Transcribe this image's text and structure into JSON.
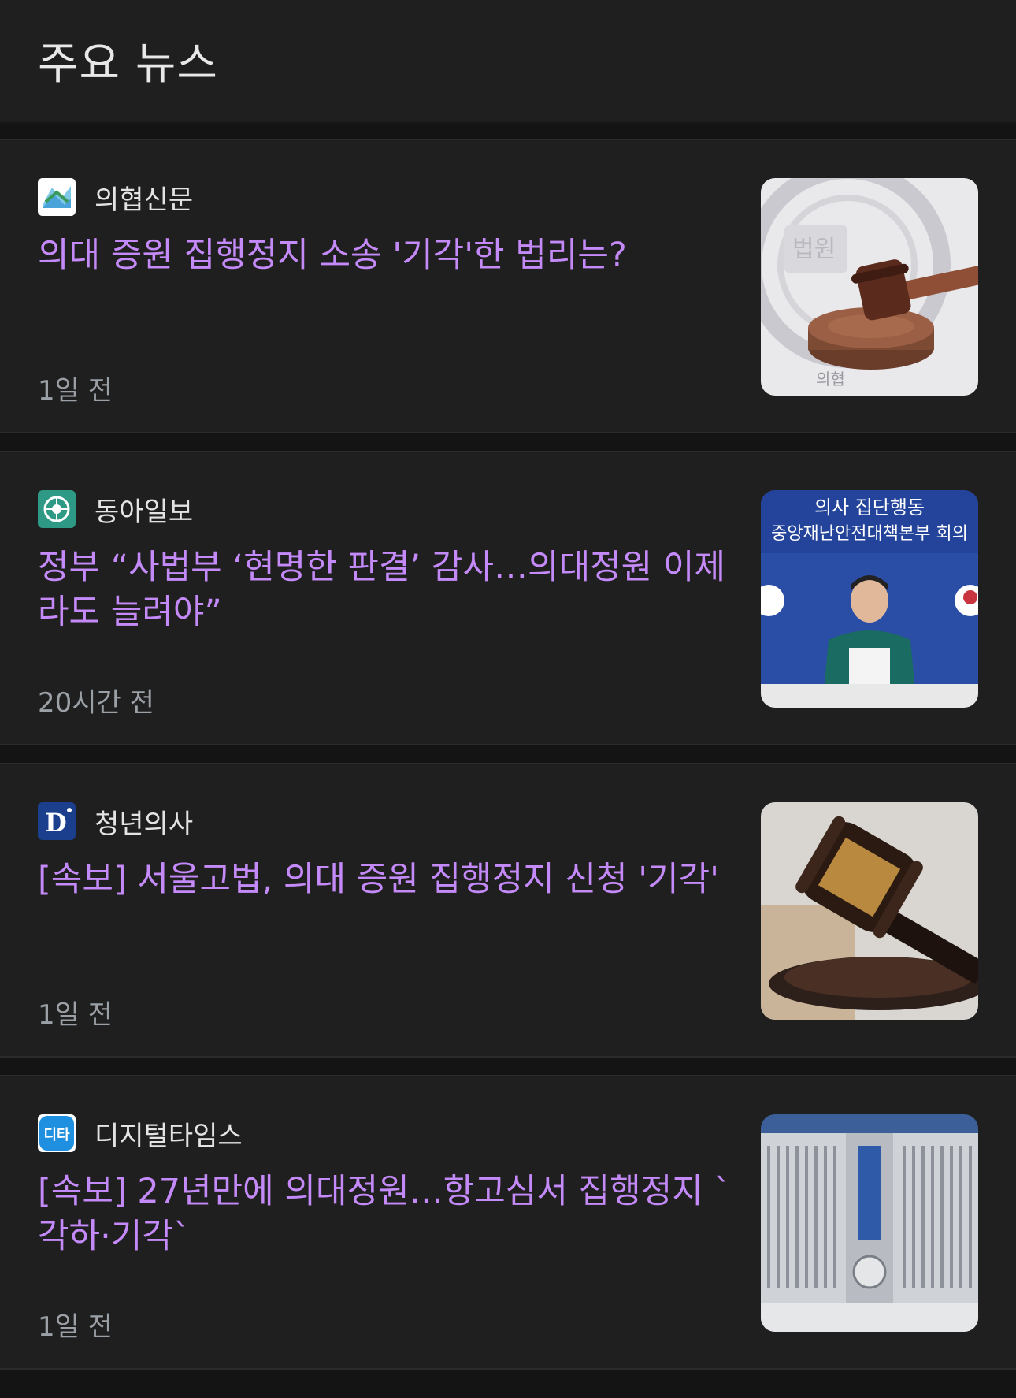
{
  "header": {
    "title": "주요 뉴스"
  },
  "articles": [
    {
      "source": "의협신문",
      "headline": "의대 증원 집행정지 소송 '기각'한 법리는?",
      "time": "1일 전",
      "logo_icon": "kma-news-logo-icon",
      "thumb_icon": "gavel-court-icon"
    },
    {
      "source": "동아일보",
      "headline": "정부 “사법부 ‘현명한 판결’ 감사…의대정원 이제라도 늘려야”",
      "time": "20시간 전",
      "logo_icon": "donga-logo-icon",
      "thumb_icon": "press-briefing-photo-icon",
      "thumb_text_1": "의사 집단행동",
      "thumb_text_2": "중앙재난안전대책본부 회의"
    },
    {
      "source": "청년의사",
      "headline": "[속보] 서울고법, 의대 증원 집행정지 신청 '기각'",
      "time": "1일 전",
      "logo_icon": "d-logo-icon",
      "thumb_icon": "gavel-photo-icon"
    },
    {
      "source": "디지털타임스",
      "headline": "[속보] 27년만에 의대정원…항고심서 집행정지 `각하·기각`",
      "time": "1일 전",
      "logo_icon": "dt-logo-icon",
      "thumb_icon": "court-building-photo-icon",
      "logo_text": "디타"
    }
  ],
  "colors": {
    "background": "#141414",
    "card": "#1f1f1f",
    "headline": "#c58af9",
    "meta": "#9aa0a6",
    "source": "#e3e3e3"
  }
}
